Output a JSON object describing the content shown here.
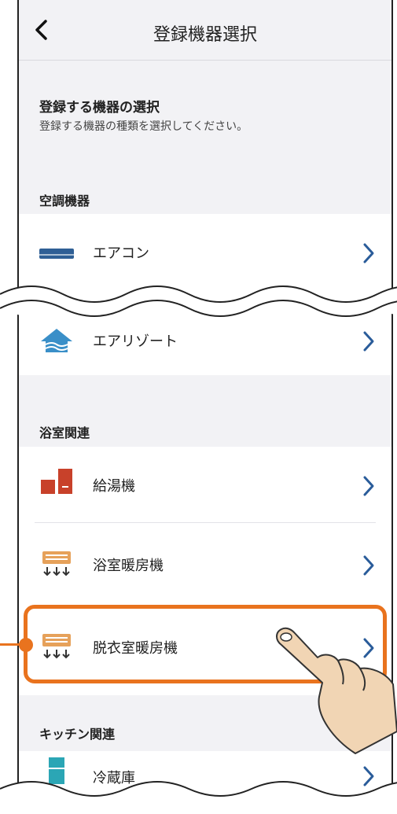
{
  "navbar": {
    "title": "登録機器選択",
    "back_icon": "chevron-left-icon"
  },
  "intro": {
    "title": "登録する機器の選択",
    "subtitle": "登録する機器の種類を選択してください。"
  },
  "sections": [
    {
      "label": "空調機器",
      "items": [
        {
          "label": "エアコン",
          "icon": "air-conditioner-icon"
        },
        {
          "label": "エアリゾート",
          "icon": "air-resort-icon"
        }
      ]
    },
    {
      "label": "浴室関連",
      "items": [
        {
          "label": "給湯機",
          "icon": "water-heater-icon"
        },
        {
          "label": "浴室暖房機",
          "icon": "bathroom-heater-icon"
        },
        {
          "label": "脱衣室暖房機",
          "icon": "dressing-room-heater-icon",
          "highlighted": true
        }
      ]
    },
    {
      "label": "キッチン関連",
      "items": [
        {
          "label": "冷蔵庫",
          "icon": "refrigerator-icon"
        }
      ]
    }
  ],
  "colors": {
    "accent": "#e9731e",
    "chevron": "#2a5c9a",
    "ac_blue": "#2f5f95",
    "resort_blue": "#3a8fc8",
    "heater_red": "#c8412a",
    "heater_tan": "#e6a15a",
    "fridge_teal": "#2ba6b5"
  }
}
